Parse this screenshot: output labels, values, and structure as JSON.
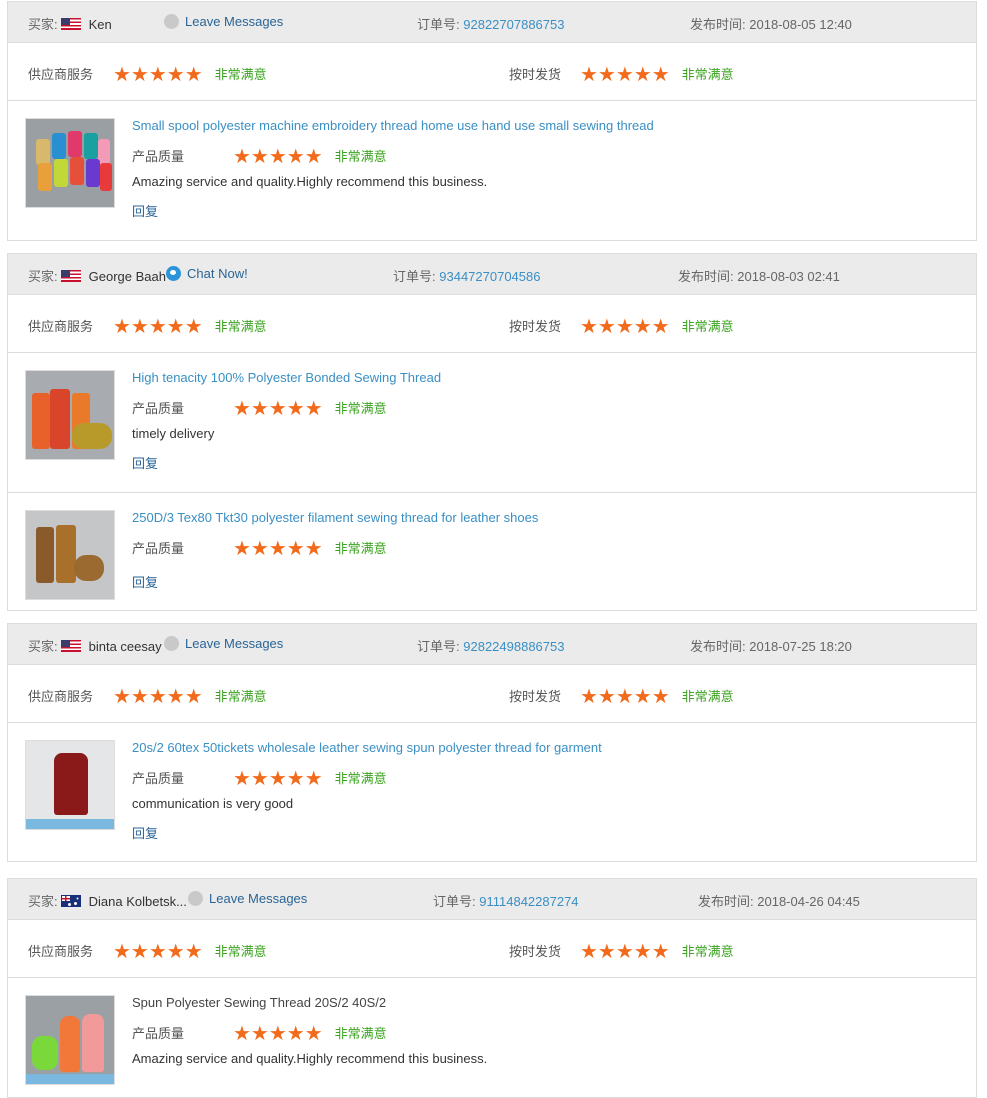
{
  "labels": {
    "buyer": "买家:",
    "order": "订单号:",
    "date": "发布时间:",
    "supplier_service": "供应商服务",
    "on_time": "按时发货",
    "product_quality": "产品质量",
    "satisfied": "非常满意",
    "reply": "回复",
    "stars": "★★★★★"
  },
  "reviews": [
    {
      "buyer": "Ken",
      "flag": "us",
      "contact": "Leave Messages",
      "order_no": "92822707886753",
      "date": "2018-08-05 12:40",
      "products": [
        {
          "title": "Small spool polyester machine embroidery thread home use hand use small sewing thread",
          "comment": "Amazing service and quality.Highly recommend this business."
        }
      ]
    },
    {
      "buyer": "George Baah",
      "flag": "us",
      "contact": "Chat Now!",
      "order_no": "93447270704586",
      "date": "2018-08-03 02:41",
      "products": [
        {
          "title": "High tenacity 100% Polyester Bonded Sewing Thread",
          "comment": "timely delivery"
        },
        {
          "title": "250D/3 Tex80 Tkt30 polyester filament sewing thread for leather shoes",
          "comment": ""
        }
      ]
    },
    {
      "buyer": "binta ceesay",
      "flag": "us",
      "contact": "Leave Messages",
      "order_no": "92822498886753",
      "date": "2018-07-25 18:20",
      "products": [
        {
          "title": "20s/2 60tex 50tickets wholesale leather sewing spun polyester thread for garment",
          "comment": "communication is very good"
        }
      ]
    },
    {
      "buyer": "Diana Kolbetsk...",
      "flag": "au",
      "contact": "Leave Messages",
      "order_no": "91114842287274",
      "date": "2018-04-26 04:45",
      "products": [
        {
          "title": "Spun Polyester Sewing Thread 20S/2 40S/2",
          "comment": "Amazing service and quality.Highly recommend this business."
        }
      ]
    }
  ],
  "colors": {
    "star": "#f26b1d",
    "satisfied": "#3aa31f",
    "link": "#3a8fc4",
    "header_bg": "#ebebeb"
  }
}
